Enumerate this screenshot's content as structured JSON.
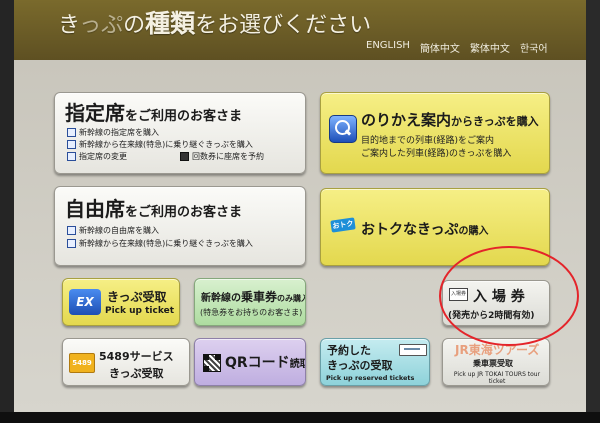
{
  "header": {
    "title_pre": "き",
    "title_obscured": "っぷ",
    "title_mid": "の",
    "title_big": "種類",
    "title_post": "をお選びください"
  },
  "languages": [
    "ENGLISH",
    "簡体中文",
    "繁体中文",
    "한국어"
  ],
  "buttons": {
    "reserved": {
      "title_big": "指定席",
      "title_small": "をご利用のお客さま",
      "items": [
        "新幹線の指定席を購入",
        "新幹線から在来線(特急)に乗り継ぐきっぷを購入",
        "指定席の変更",
        "回数券に座席を予約"
      ]
    },
    "transfer": {
      "title_big": "のりかえ案内",
      "title_small": "からきっぷを購入",
      "lines": [
        "目的地までの列車(経路)をご案内",
        "ご案内した列車(経路)のきっぷを購入"
      ]
    },
    "unreserved": {
      "title_big": "自由席",
      "title_small": "をご利用のお客さま",
      "items": [
        "新幹線の自由席を購入",
        "新幹線から在来線(特急)に乗り継ぐきっぷを購入"
      ]
    },
    "discount": {
      "tag": "おトク",
      "title_big": "おトクなきっぷ",
      "title_small": "の購入"
    },
    "ex_pickup": {
      "logo": "EX",
      "label_jp": "きっぷ受取",
      "label_en": "Pick up ticket"
    },
    "shinkansen_only": {
      "title_pre": "新幹線の",
      "title_big": "乗車券",
      "title_post": "のみ購入",
      "note": "(特急券をお持ちのお客さま)"
    },
    "platform": {
      "tag": "入場券",
      "label": "入 場 券",
      "note": "(発売から2時間有効)"
    },
    "service5489": {
      "badge": "5489",
      "line1": "5489サービス",
      "line2": "きっぷ受取"
    },
    "qr": {
      "label_big": "QRコード",
      "label_small": "読取"
    },
    "reserved_pickup": {
      "line1": "予約した",
      "line2": "きっぷの受取",
      "label_en": "Pick up reserved tickets"
    },
    "jr_tour": {
      "title": "JR東海ツアーズ",
      "sub": "乗車票受取",
      "label_en": "Pick up JR TOKAI TOURS tour ticket"
    }
  }
}
